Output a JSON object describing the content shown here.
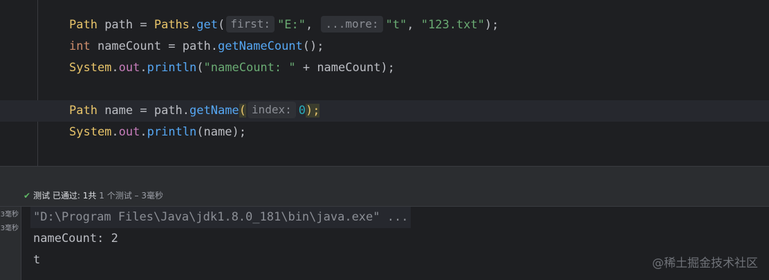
{
  "editor": {
    "line1": {
      "type": "Path",
      "var": " path = ",
      "cls": "Paths",
      "dot": ".",
      "method": "get",
      "open": "(",
      "hint1": "first:",
      "arg1": "\"E:\"",
      "comma1": ", ",
      "hint2": "...more:",
      "arg2": "\"t\"",
      "comma2": ", ",
      "arg3": "\"123.txt\"",
      "close": ");"
    },
    "line2": {
      "kw": "int",
      "rest": " nameCount = path.",
      "method": "getNameCount",
      "tail": "();"
    },
    "line3": {
      "cls": "System",
      "dot1": ".",
      "field": "out",
      "dot2": ".",
      "method": "println",
      "open": "(",
      "str": "\"nameCount: \"",
      "rest": " + nameCount);"
    },
    "line4": {
      "type": "Path",
      "rest": " name = path.",
      "method": "getName",
      "open": "(",
      "hint": "index:",
      "num": "0",
      "close": ");"
    },
    "line5": {
      "cls": "System",
      "dot1": ".",
      "field": "out",
      "dot2": ".",
      "method": "println",
      "tail": "(name);"
    }
  },
  "status": {
    "check": "✔",
    "state_label": "测试",
    "passed": "已通过:",
    "count": "1共",
    "rest": "1 个测试 – 3毫秒"
  },
  "console_left": {
    "t1": "3毫秒",
    "t2": "3毫秒"
  },
  "console": {
    "cmd": "\"D:\\Program Files\\Java\\jdk1.8.0_181\\bin\\java.exe\" ...",
    "line2": "nameCount: 2",
    "line3": "t"
  },
  "watermark": "@稀土掘金技术社区"
}
